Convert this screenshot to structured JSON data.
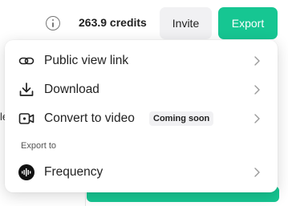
{
  "header": {
    "credits": "263.9 credits",
    "invite_label": "Invite",
    "export_label": "Export"
  },
  "background": {
    "left_fragment": "le"
  },
  "menu": {
    "items": [
      {
        "label": "Public view link",
        "icon": "link-icon"
      },
      {
        "label": "Download",
        "icon": "download-icon"
      },
      {
        "label": "Convert to video",
        "icon": "video-camera-icon",
        "badge": "Coming soon"
      }
    ],
    "section_label": "Export to",
    "integrations": [
      {
        "label": "Frequency",
        "icon": "frequency-logo-icon"
      }
    ]
  },
  "colors": {
    "accent": "#16c692",
    "button_bg": "#f1f1f3"
  }
}
